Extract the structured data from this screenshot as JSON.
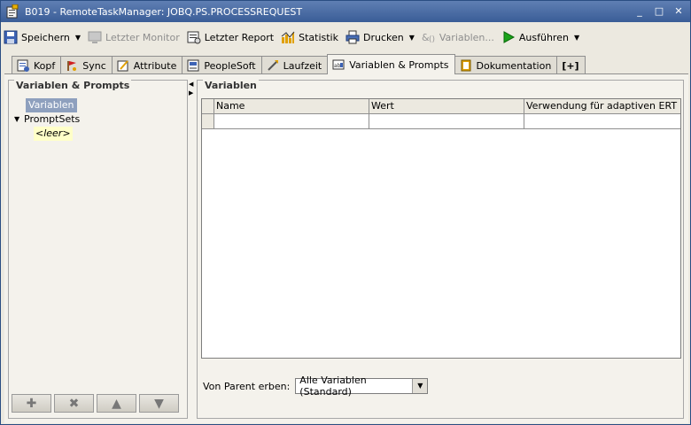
{
  "window": {
    "title": "B019 - RemoteTaskManager: JOBQ.PS.PROCESSREQUEST",
    "controls": {
      "minimize": "_",
      "maximize": "□",
      "close": "✕"
    }
  },
  "toolbar": {
    "save": "Speichern",
    "last_monitor": "Letzter Monitor",
    "last_report": "Letzter Report",
    "statistics": "Statistik",
    "print": "Drucken",
    "variables": "Variablen...",
    "execute": "Ausführen",
    "dropdown_glyph": "▼"
  },
  "tabs": [
    {
      "label": "Kopf"
    },
    {
      "label": "Sync"
    },
    {
      "label": "Attribute"
    },
    {
      "label": "PeopleSoft"
    },
    {
      "label": "Laufzeit"
    },
    {
      "label": "Variablen & Prompts"
    },
    {
      "label": "Dokumentation"
    },
    {
      "label": "[+]"
    }
  ],
  "left_panel": {
    "title": "Variablen & Prompts",
    "tree": {
      "variables": "Variablen",
      "promptsets": "PromptSets",
      "empty": "<leer>"
    },
    "buttons": {
      "add": "✚",
      "delete": "✖",
      "up": "▲",
      "down": "▼"
    }
  },
  "right_panel": {
    "title": "Variablen",
    "columns": [
      "Name",
      "Wert",
      "Verwendung für adaptiven ERT als"
    ],
    "inherit_label": "Von Parent erben:",
    "inherit_value": "Alle Variablen (Standard)"
  },
  "splitter": {
    "left": "◀",
    "right": "▶"
  },
  "colors": {
    "title_bar": "#3a5d97",
    "selection": "#8ea0be",
    "empty_highlight": "#ffffc8",
    "execute_green": "#1aa31a"
  }
}
